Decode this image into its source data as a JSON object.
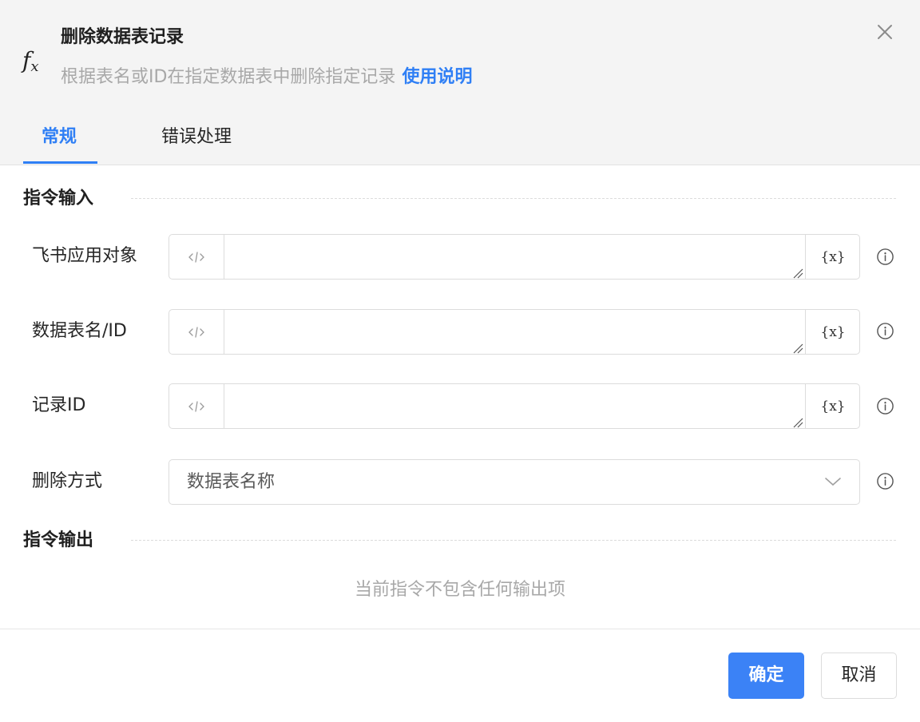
{
  "dialog": {
    "title": "删除数据表记录",
    "description": "根据表名或ID在指定数据表中删除指定记录",
    "help_link": "使用说明",
    "icon": "fx-icon"
  },
  "tabs": [
    {
      "label": "常规",
      "active": true
    },
    {
      "label": "错误处理",
      "active": false
    }
  ],
  "input_section": {
    "title": "指令输入",
    "fields": [
      {
        "label": "飞书应用对象",
        "value": "",
        "var_button": "{x}"
      },
      {
        "label": "数据表名/ID",
        "value": "",
        "var_button": "{x}"
      },
      {
        "label": "记录ID",
        "value": "",
        "var_button": "{x}"
      }
    ],
    "select": {
      "label": "删除方式",
      "value": "数据表名称"
    }
  },
  "output_section": {
    "title": "指令输出",
    "empty_text": "当前指令不包含任何输出项"
  },
  "footer": {
    "ok_label": "确定",
    "cancel_label": "取消"
  },
  "colors": {
    "accent": "#2f7ff5",
    "primary_button": "#3b82f6",
    "header_bg": "#f4f4f4"
  }
}
